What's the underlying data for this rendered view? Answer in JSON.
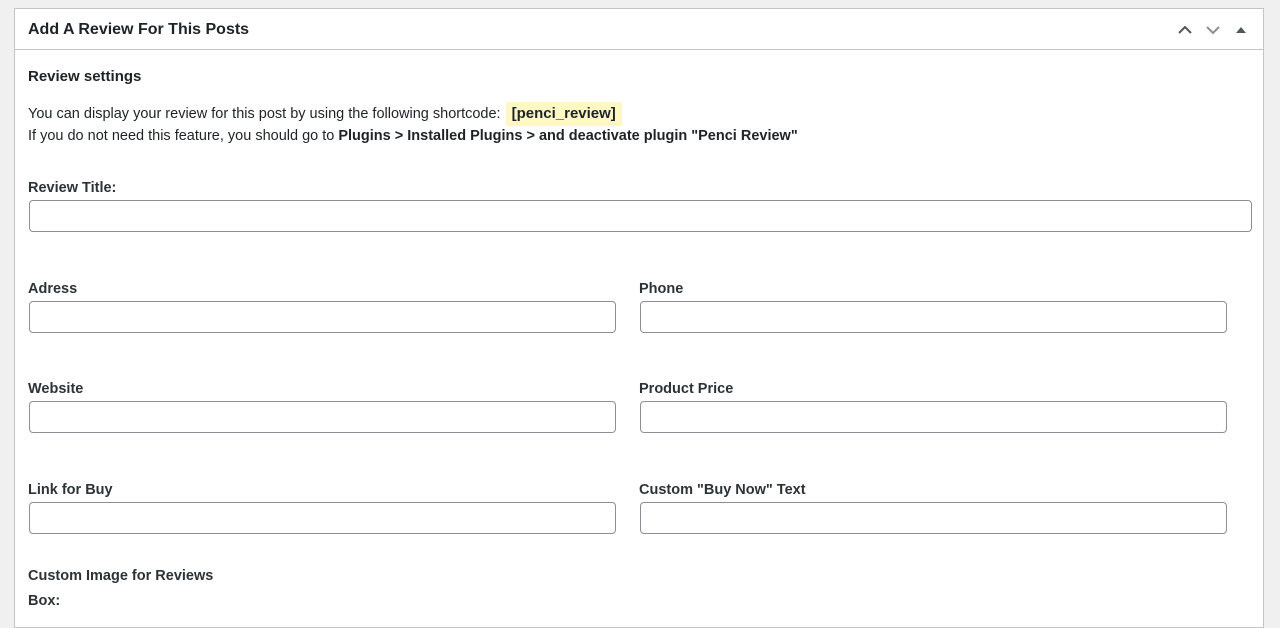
{
  "postbox": {
    "title": "Add A Review For This Posts",
    "controls": [
      {
        "name": "move-up-icon",
        "glyph": "chevron-up"
      },
      {
        "name": "move-down-icon",
        "glyph": "chevron-down"
      },
      {
        "name": "toggle-panel-icon",
        "glyph": "triangle-up"
      }
    ]
  },
  "settings": {
    "heading": "Review settings",
    "line1_text": "You can display your review for this post by using the following shortcode:",
    "shortcode": "[penci_review]",
    "line2_prefix": "If you do not need this feature, you should go to ",
    "line2_bold": "Plugins > Installed Plugins > and deactivate plugin \"Penci Review\""
  },
  "fields": {
    "review_title": {
      "label": "Review Title:",
      "value": ""
    },
    "address": {
      "label": "Adress",
      "value": ""
    },
    "phone": {
      "label": "Phone",
      "value": ""
    },
    "website": {
      "label": "Website",
      "value": ""
    },
    "product_price": {
      "label": "Product Price",
      "value": ""
    },
    "link_for_buy": {
      "label": "Link for Buy",
      "value": ""
    },
    "buy_now_text": {
      "label": "Custom \"Buy Now\" Text",
      "value": ""
    },
    "custom_image": {
      "label_line1": "Custom Image for Reviews",
      "label_line2": "Box:"
    }
  },
  "colors": {
    "shortcode_highlight": "#fff8c5",
    "border": "#c3c4c7",
    "input_border": "#8c8f94"
  }
}
